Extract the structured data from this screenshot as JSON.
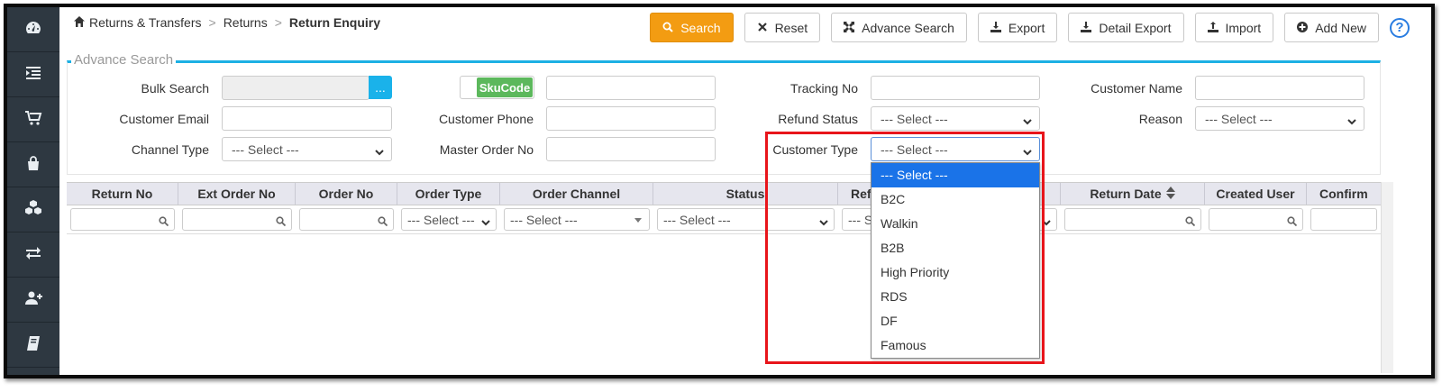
{
  "breadcrumb": {
    "items": [
      "Returns & Transfers",
      "Returns"
    ],
    "current": "Return Enquiry",
    "separator": ">"
  },
  "toolbar": {
    "search": "Search",
    "reset": "Reset",
    "advance_search": "Advance Search",
    "export": "Export",
    "detail_export": "Detail Export",
    "import": "Import",
    "add_new": "Add New",
    "help": "?"
  },
  "advance_search": {
    "legend": "Advance Search",
    "bulk_search_label": "Bulk Search",
    "bulk_btn": "...",
    "skucode_toggle": "SkuCode",
    "tracking_no_label": "Tracking No",
    "customer_name_label": "Customer Name",
    "customer_email_label": "Customer Email",
    "customer_phone_label": "Customer Phone",
    "refund_status_label": "Refund Status",
    "refund_status_value": "--- Select ---",
    "reason_label": "Reason",
    "reason_value": "--- Select ---",
    "channel_type_label": "Channel Type",
    "channel_type_value": "--- Select ---",
    "master_order_no_label": "Master Order No",
    "customer_type_label": "Customer Type",
    "customer_type_value": "--- Select ---"
  },
  "customer_type_options": [
    "--- Select ---",
    "B2C",
    "Walkin",
    "B2B",
    "High Priority",
    "RDS",
    "DF",
    "Famous"
  ],
  "grid": {
    "columns": [
      "Return No",
      "Ext Order No",
      "Order No",
      "Order Type",
      "Order Channel",
      "Status",
      "Ref",
      "",
      "Return Date",
      "Created User",
      "Confirm"
    ],
    "filters": {
      "order_type": "--- Select ---",
      "order_channel": "--- Select ---",
      "status": "--- Select ---",
      "ref_partial": "--- S"
    }
  },
  "colors": {
    "accent": "#1cb0e4",
    "primary_button": "#f39c12",
    "sidebar": "#2e3841",
    "highlight": "#e8151b",
    "selected_option": "#1a73e8"
  }
}
